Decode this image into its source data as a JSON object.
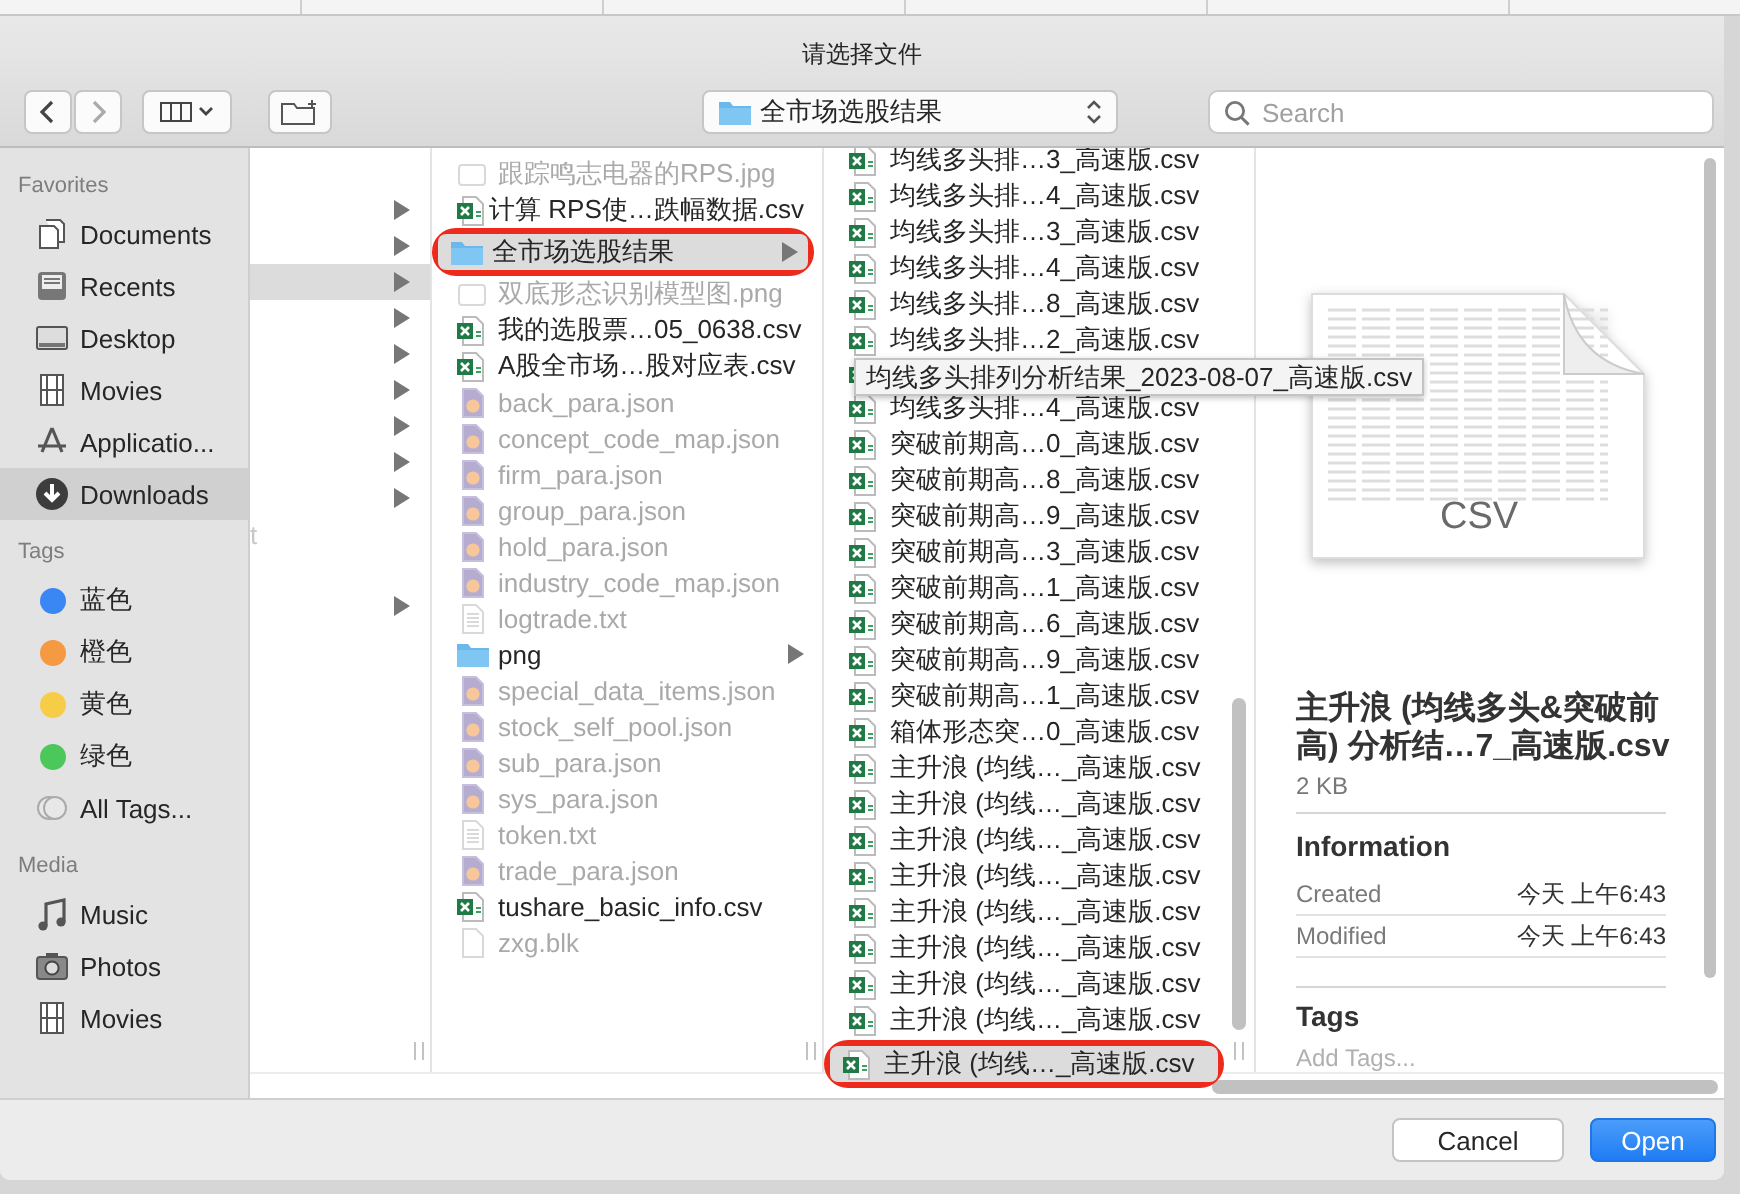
{
  "window": {
    "title": "请选择文件"
  },
  "toolbar": {
    "location": "全市场选股结果",
    "search": {
      "placeholder": "Search"
    }
  },
  "sidebar": {
    "sections": [
      {
        "heading": "Favorites",
        "items": [
          {
            "label": "Documents",
            "kind": "documents",
            "selected": false
          },
          {
            "label": "Recents",
            "kind": "recents",
            "selected": false
          },
          {
            "label": "Desktop",
            "kind": "desktop",
            "selected": false
          },
          {
            "label": "Movies",
            "kind": "movies",
            "selected": false
          },
          {
            "label": "Applicatio...",
            "kind": "applications",
            "selected": false
          },
          {
            "label": "Downloads",
            "kind": "downloads",
            "selected": true
          }
        ]
      },
      {
        "heading": "Tags",
        "items": [
          {
            "label": "蓝色",
            "kind": "tag",
            "color": "#3a86f5",
            "selected": false
          },
          {
            "label": "橙色",
            "kind": "tag",
            "color": "#f59a42",
            "selected": false
          },
          {
            "label": "黄色",
            "kind": "tag",
            "color": "#f7cd47",
            "selected": false
          },
          {
            "label": "绿色",
            "kind": "tag",
            "color": "#4cc85a",
            "selected": false
          },
          {
            "label": "All Tags...",
            "kind": "all-tags",
            "selected": false
          }
        ]
      },
      {
        "heading": "Media",
        "items": [
          {
            "label": "Music",
            "kind": "music",
            "selected": false
          },
          {
            "label": "Photos",
            "kind": "photos",
            "selected": false
          },
          {
            "label": "Movies",
            "kind": "movies",
            "selected": false
          }
        ]
      }
    ]
  },
  "columns": [
    {
      "rows": [
        {
          "kind": "empty"
        },
        {
          "kind": "folder",
          "expandable": true,
          "selected": false
        },
        {
          "kind": "folder",
          "expandable": true,
          "selected": false
        },
        {
          "kind": "folder",
          "expandable": true,
          "selected": true
        },
        {
          "kind": "folder",
          "expandable": true,
          "selected": false
        },
        {
          "kind": "folder",
          "expandable": true,
          "selected": false
        },
        {
          "kind": "folder",
          "expandable": true,
          "selected": false
        },
        {
          "kind": "folder",
          "expandable": true,
          "selected": false
        },
        {
          "kind": "folder",
          "expandable": true,
          "selected": false
        },
        {
          "kind": "folder",
          "expandable": true,
          "selected": false
        },
        {
          "kind": "file",
          "name": "t"
        },
        {
          "kind": "empty"
        },
        {
          "kind": "folder",
          "expandable": true,
          "selected": false
        }
      ]
    },
    {
      "rows": [
        {
          "name": "跟踪鸣志电器的RPS.jpg",
          "kind": "image",
          "disabled": true,
          "selected": false,
          "annotated": false
        },
        {
          "name": "计算 RPS使…跌幅数据.csv",
          "kind": "csv",
          "disabled": false,
          "selected": false,
          "annotated": false
        },
        {
          "name": "全市场选股结果",
          "kind": "folder",
          "disabled": false,
          "selected": true,
          "annotated": true
        },
        {
          "name": "双底形态识别模型图.png",
          "kind": "image",
          "disabled": true,
          "selected": false,
          "annotated": false
        },
        {
          "name": "我的选股票…05_0638.csv",
          "kind": "csv",
          "disabled": false,
          "selected": false,
          "annotated": false
        },
        {
          "name": "A股全市场…股对应表.csv",
          "kind": "csv",
          "disabled": false,
          "selected": false,
          "annotated": false
        },
        {
          "name": "back_para.json",
          "kind": "json",
          "disabled": true,
          "selected": false,
          "annotated": false
        },
        {
          "name": "concept_code_map.json",
          "kind": "json",
          "disabled": true,
          "selected": false,
          "annotated": false
        },
        {
          "name": "firm_para.json",
          "kind": "json",
          "disabled": true,
          "selected": false,
          "annotated": false
        },
        {
          "name": "group_para.json",
          "kind": "json",
          "disabled": true,
          "selected": false,
          "annotated": false
        },
        {
          "name": "hold_para.json",
          "kind": "json",
          "disabled": true,
          "selected": false,
          "annotated": false
        },
        {
          "name": "industry_code_map.json",
          "kind": "json",
          "disabled": true,
          "selected": false,
          "annotated": false
        },
        {
          "name": "logtrade.txt",
          "kind": "text",
          "disabled": true,
          "selected": false,
          "annotated": false
        },
        {
          "name": "png",
          "kind": "folder",
          "disabled": false,
          "selected": false,
          "annotated": false
        },
        {
          "name": "special_data_items.json",
          "kind": "json",
          "disabled": true,
          "selected": false,
          "annotated": false
        },
        {
          "name": "stock_self_pool.json",
          "kind": "json",
          "disabled": true,
          "selected": false,
          "annotated": false
        },
        {
          "name": "sub_para.json",
          "kind": "json",
          "disabled": true,
          "selected": false,
          "annotated": false
        },
        {
          "name": "sys_para.json",
          "kind": "json",
          "disabled": true,
          "selected": false,
          "annotated": false
        },
        {
          "name": "token.txt",
          "kind": "text",
          "disabled": true,
          "selected": false,
          "annotated": false
        },
        {
          "name": "trade_para.json",
          "kind": "json",
          "disabled": true,
          "selected": false,
          "annotated": false
        },
        {
          "name": "tushare_basic_info.csv",
          "kind": "csv",
          "disabled": false,
          "selected": false,
          "annotated": false
        },
        {
          "name": "zxg.blk",
          "kind": "blank",
          "disabled": true,
          "selected": false,
          "annotated": false
        }
      ]
    },
    {
      "rows": [
        {
          "name": "均线多头排…3_高速版.csv",
          "kind": "csv",
          "disabled": false,
          "selected": false,
          "annotated": false
        },
        {
          "name": "均线多头排…4_高速版.csv",
          "kind": "csv",
          "disabled": false,
          "selected": false,
          "annotated": false
        },
        {
          "name": "均线多头排…3_高速版.csv",
          "kind": "csv",
          "disabled": false,
          "selected": false,
          "annotated": false
        },
        {
          "name": "均线多头排…4_高速版.csv",
          "kind": "csv",
          "disabled": false,
          "selected": false,
          "annotated": false
        },
        {
          "name": "均线多头排…8_高速版.csv",
          "kind": "csv",
          "disabled": false,
          "selected": false,
          "annotated": false
        },
        {
          "name": "均线多头排…2_高速版.csv",
          "kind": "csv",
          "disabled": false,
          "selected": false,
          "annotated": false
        },
        {
          "kind": "csv",
          "tooltip": "均线多头排列分析结果_2023-08-07_高速版.csv",
          "disabled": false,
          "selected": false,
          "annotated": false
        },
        {
          "name": "均线多头排…4_高速版.csv",
          "kind": "csv",
          "disabled": false,
          "selected": false,
          "annotated": false
        },
        {
          "name": "突破前期高…0_高速版.csv",
          "kind": "csv",
          "disabled": false,
          "selected": false,
          "annotated": false
        },
        {
          "name": "突破前期高…8_高速版.csv",
          "kind": "csv",
          "disabled": false,
          "selected": false,
          "annotated": false
        },
        {
          "name": "突破前期高…9_高速版.csv",
          "kind": "csv",
          "disabled": false,
          "selected": false,
          "annotated": false
        },
        {
          "name": "突破前期高…3_高速版.csv",
          "kind": "csv",
          "disabled": false,
          "selected": false,
          "annotated": false
        },
        {
          "name": "突破前期高…1_高速版.csv",
          "kind": "csv",
          "disabled": false,
          "selected": false,
          "annotated": false
        },
        {
          "name": "突破前期高…6_高速版.csv",
          "kind": "csv",
          "disabled": false,
          "selected": false,
          "annotated": false
        },
        {
          "name": "突破前期高…9_高速版.csv",
          "kind": "csv",
          "disabled": false,
          "selected": false,
          "annotated": false
        },
        {
          "name": "突破前期高…1_高速版.csv",
          "kind": "csv",
          "disabled": false,
          "selected": false,
          "annotated": false
        },
        {
          "name": "箱体形态突…0_高速版.csv",
          "kind": "csv",
          "disabled": false,
          "selected": false,
          "annotated": false
        },
        {
          "name": "主升浪 (均线…_高速版.csv",
          "kind": "csv",
          "disabled": false,
          "selected": false,
          "annotated": false
        },
        {
          "name": "主升浪 (均线…_高速版.csv",
          "kind": "csv",
          "disabled": false,
          "selected": false,
          "annotated": false
        },
        {
          "name": "主升浪 (均线…_高速版.csv",
          "kind": "csv",
          "disabled": false,
          "selected": false,
          "annotated": false
        },
        {
          "name": "主升浪 (均线…_高速版.csv",
          "kind": "csv",
          "disabled": false,
          "selected": false,
          "annotated": false
        },
        {
          "name": "主升浪 (均线…_高速版.csv",
          "kind": "csv",
          "disabled": false,
          "selected": false,
          "annotated": false
        },
        {
          "name": "主升浪 (均线…_高速版.csv",
          "kind": "csv",
          "disabled": false,
          "selected": false,
          "annotated": false
        },
        {
          "name": "主升浪 (均线…_高速版.csv",
          "kind": "csv",
          "disabled": false,
          "selected": false,
          "annotated": false
        },
        {
          "name": "主升浪 (均线…_高速版.csv",
          "kind": "csv",
          "disabled": false,
          "selected": false,
          "annotated": false
        },
        {
          "name": "主升浪 (均线…_高速版.csv",
          "kind": "csv",
          "disabled": false,
          "selected": true,
          "annotated": true
        }
      ]
    }
  ],
  "preview": {
    "icon_label": "CSV",
    "name": "主升浪 (均线多头&突破前高) 分析结…7_高速版.csv",
    "size": "2 KB",
    "info_heading": "Information",
    "info": [
      {
        "label": "Created",
        "value": "今天 上午6:43"
      },
      {
        "label": "Modified",
        "value": "今天 上午6:43"
      }
    ],
    "tags_heading": "Tags",
    "tags_field": {
      "placeholder": "Add Tags..."
    }
  },
  "buttons": [
    {
      "label": "Cancel",
      "kind": "default"
    },
    {
      "label": "Open",
      "kind": "primary"
    }
  ]
}
